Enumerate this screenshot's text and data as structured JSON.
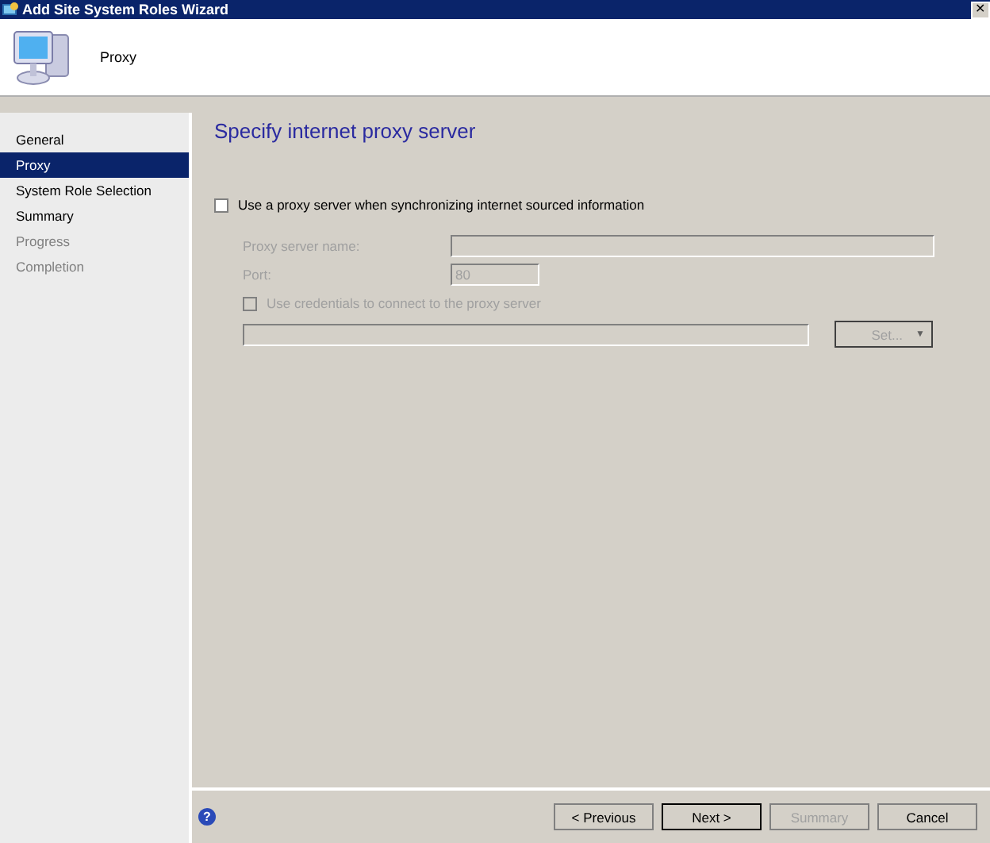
{
  "window": {
    "title": "Add Site System Roles Wizard",
    "close": "✕"
  },
  "header": {
    "title": "Proxy"
  },
  "sidebar": {
    "items": [
      {
        "label": "General",
        "selected": false,
        "disabled": false
      },
      {
        "label": "Proxy",
        "selected": true,
        "disabled": false
      },
      {
        "label": "System Role Selection",
        "selected": false,
        "disabled": false
      },
      {
        "label": "Summary",
        "selected": false,
        "disabled": false
      },
      {
        "label": "Progress",
        "selected": false,
        "disabled": true
      },
      {
        "label": "Completion",
        "selected": false,
        "disabled": true
      }
    ]
  },
  "page": {
    "heading": "Specify internet proxy server",
    "use_proxy": {
      "label": "Use a proxy server when synchronizing internet sourced information",
      "checked": false
    },
    "proxy_server_name": {
      "label": "Proxy server name:",
      "disabled": true
    },
    "port": {
      "label": "Port:",
      "value": "80",
      "disabled": true
    },
    "use_credentials": {
      "label": "Use credentials to connect to the proxy server",
      "checked": false,
      "disabled": true
    },
    "set_button": {
      "label": "Set...",
      "caret": "▼",
      "disabled": true
    }
  },
  "footer": {
    "help": "?",
    "buttons": [
      {
        "label": "< Previous",
        "disabled": false,
        "default": false
      },
      {
        "label": "Next >",
        "disabled": false,
        "default": true
      },
      {
        "label": "Summary",
        "disabled": true,
        "default": false
      },
      {
        "label": "Cancel",
        "disabled": false,
        "default": false
      }
    ]
  }
}
